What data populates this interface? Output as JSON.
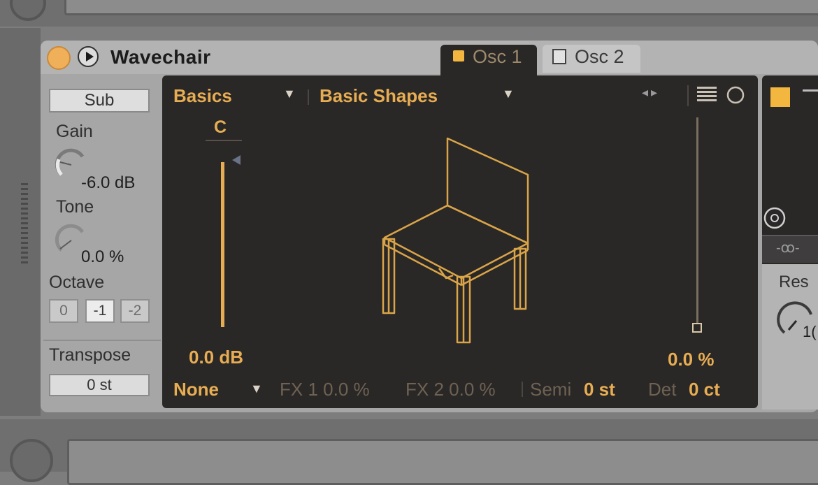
{
  "device": {
    "title": "Wavechair",
    "tabs": [
      {
        "label": "Osc 1",
        "active": true
      },
      {
        "label": "Osc 2",
        "active": false
      }
    ]
  },
  "left": {
    "sub_button": "Sub",
    "gain_label": "Gain",
    "gain_value": "-6.0 dB",
    "tone_label": "Tone",
    "tone_value": "0.0 %",
    "octave_label": "Octave",
    "octave_options": [
      "0",
      "-1",
      "-2"
    ],
    "octave_selected": "-1",
    "transpose_label": "Transpose",
    "transpose_value": "0 st"
  },
  "display": {
    "category": "Basics",
    "wavetable": "Basic Shapes",
    "note": "C",
    "gain": "0.0 dB",
    "position": "0.0 %",
    "fx_mode": "None",
    "fx1": "FX 1 0.0 %",
    "fx2": "FX 2 0.0 %",
    "semi_label": "Semi",
    "semi_value": "0 st",
    "det_label": "Det",
    "det_value": "0 ct"
  },
  "right": {
    "res_label": "Res",
    "res_value": "1("
  },
  "colors": {
    "accent": "#e7ad52",
    "display_bg": "#2a2727",
    "panel_bg": "#a6a6a6"
  },
  "icons": [
    "power-icon",
    "play-icon",
    "menu-icon",
    "circle-icon",
    "chevron-down-icon",
    "chevron-left-right-icon",
    "link-icon"
  ]
}
